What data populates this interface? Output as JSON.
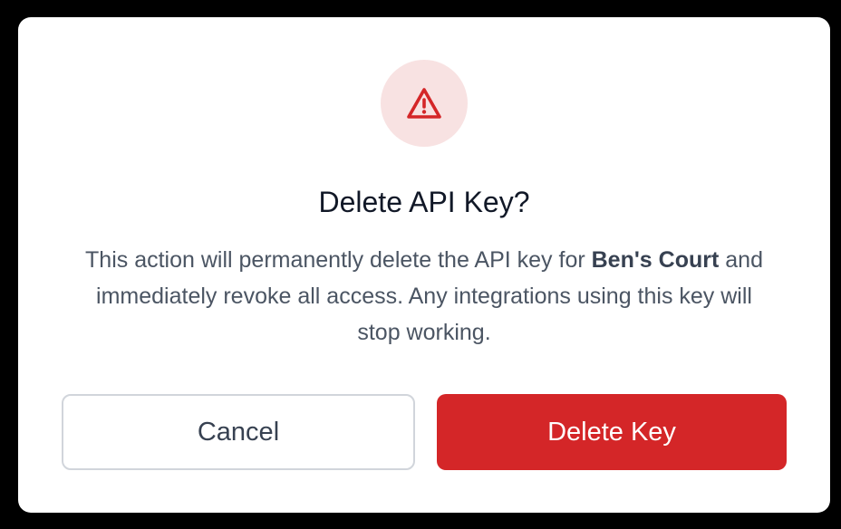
{
  "dialog": {
    "icon": "warning-triangle-icon",
    "accent_color": "#d42628",
    "icon_bg_color": "#f8e2e2",
    "title": "Delete API Key?",
    "message_before": "This action will permanently delete the API key for ",
    "message_emphasis": "Ben's Court",
    "message_after": " and immediately revoke all access. Any integrations using this key will stop working.",
    "cancel_label": "Cancel",
    "confirm_label": "Delete Key"
  }
}
